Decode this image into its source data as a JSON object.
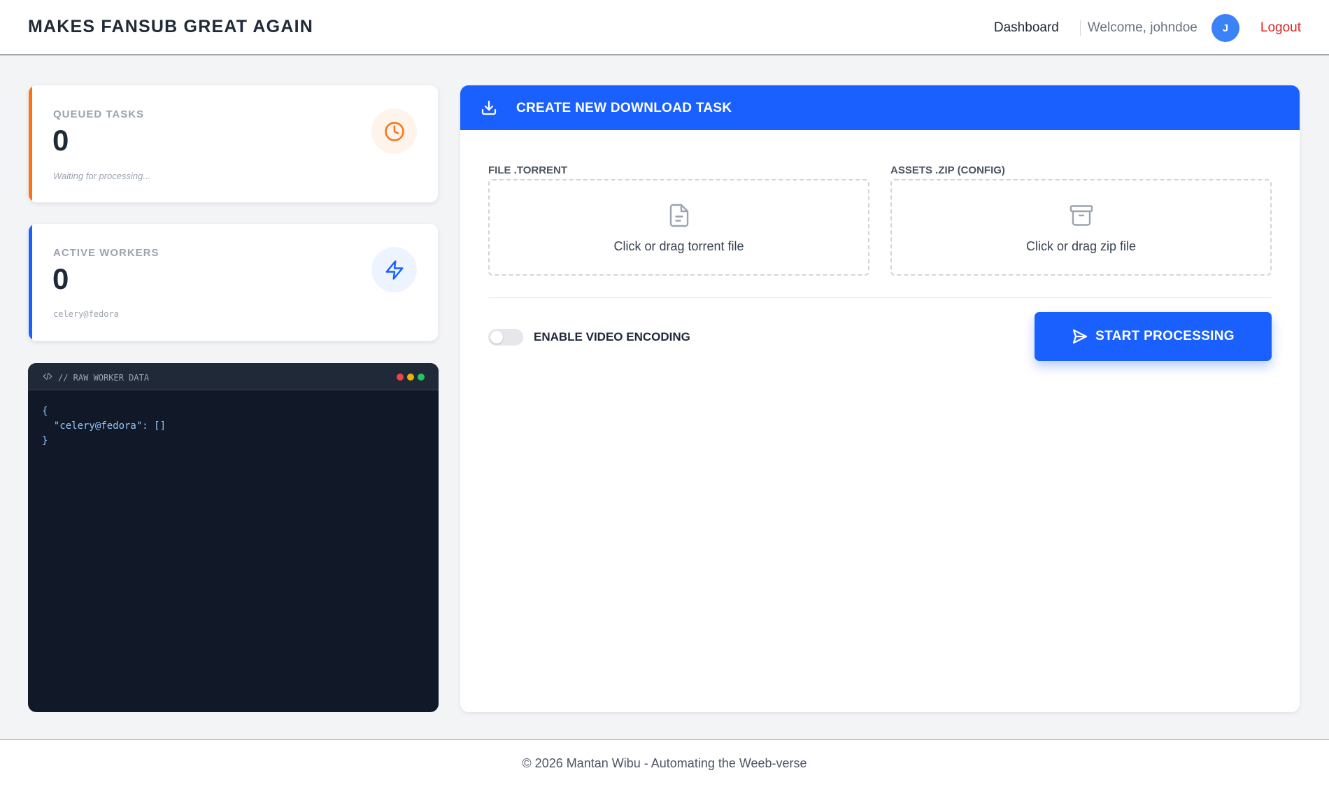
{
  "navbar": {
    "brand": "MAKES FANSUB GREAT AGAIN",
    "dashboard_link": "Dashboard",
    "welcome_text": "Welcome, johndoe",
    "avatar_initial": "J",
    "logout_link": "Logout"
  },
  "stats": {
    "queued": {
      "label": "QUEUED TASKS",
      "value": "0",
      "subtext": "Waiting for processing...",
      "icon": "clock-icon",
      "accent_color": "#f97316"
    },
    "workers": {
      "label": "ACTIVE WORKERS",
      "value": "0",
      "subtext": "celery@fedora",
      "icon": "lightning-icon",
      "accent_color": "#1a60ff"
    }
  },
  "terminal": {
    "title": "// RAW WORKER DATA",
    "content": "{\n  \"celery@fedora\": []\n}"
  },
  "task_panel": {
    "title": "CREATE NEW DOWNLOAD TASK",
    "torrent_label": "FILE .TORRENT",
    "torrent_prompt": "Click or drag torrent file",
    "zip_label": "ASSETS .ZIP (CONFIG)",
    "zip_prompt": "Click or drag zip file",
    "encoding_toggle_label": "ENABLE VIDEO ENCODING",
    "encoding_enabled": false,
    "start_button": "START PROCESSING"
  },
  "footer": {
    "text": "© 2026 Mantan Wibu - Automating the Weeb-verse"
  },
  "colors": {
    "primary": "#1a60ff",
    "orange": "#f97316",
    "danger": "#dc2626",
    "terminal_bg": "#111827"
  }
}
